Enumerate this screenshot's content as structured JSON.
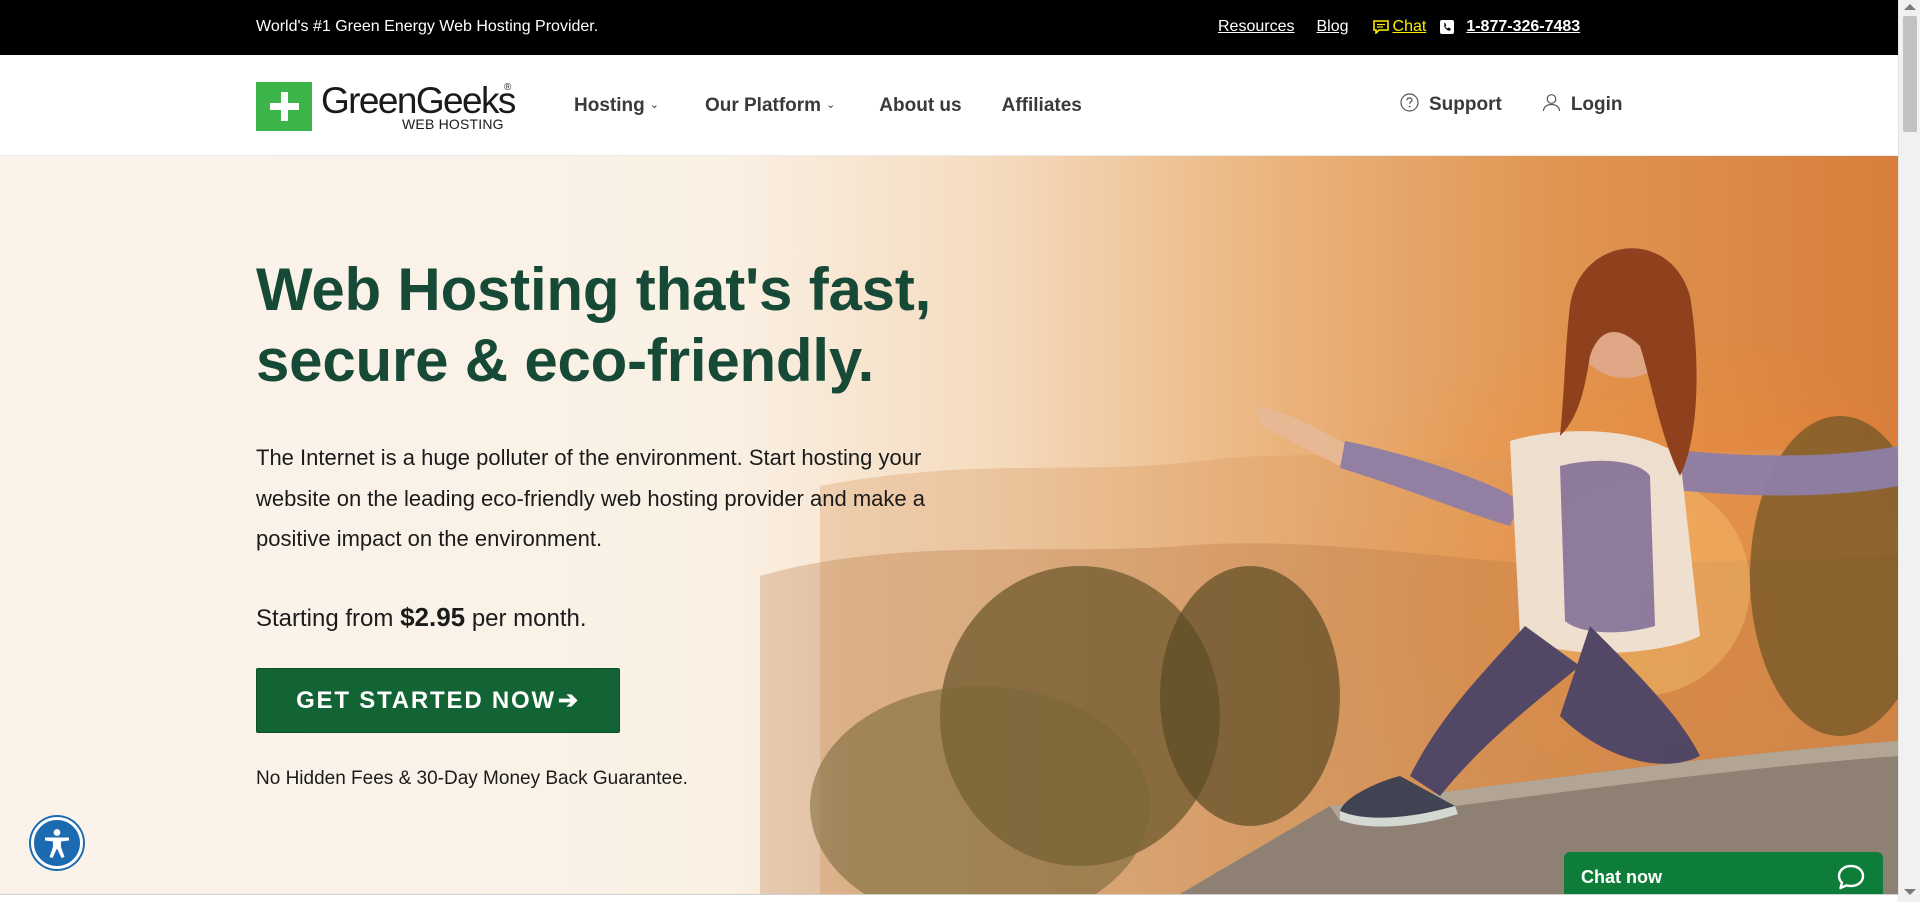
{
  "topbar": {
    "tagline": "World's #1 Green Energy Web Hosting Provider.",
    "resources": "Resources",
    "blog": "Blog",
    "chat": "Chat",
    "phone": "1-877-326-7483"
  },
  "header": {
    "logo_brand": "GreenGeeks",
    "logo_reg": "®",
    "logo_sub": "WEB HOSTING",
    "nav": {
      "hosting": "Hosting",
      "platform": "Our Platform",
      "about": "About us",
      "affiliates": "Affiliates"
    },
    "support": "Support",
    "login": "Login"
  },
  "hero": {
    "headline_line1": "Web Hosting that's fast,",
    "headline_line2": "secure & eco-friendly.",
    "lede": "The Internet is a huge polluter of the environment. Start hosting your website on the leading eco-friendly web hosting provider and make a positive impact on the environment.",
    "price_prefix": "Starting from",
    "price_value": "$2.95",
    "price_suffix": "per month.",
    "cta": "GET STARTED NOW",
    "cta_arrow": "➔",
    "guarantee": "No Hidden Fees & 30-Day Money Back Guarantee."
  },
  "chat_widget": {
    "label": "Chat now"
  },
  "colors": {
    "topbar_bg": "#000000",
    "brand_green": "#3bb44a",
    "headline_green": "#164936",
    "cta_green": "#126434",
    "chat_yellow": "#ffee00",
    "chat_widget_green": "#0f7d3a",
    "a11y_blue": "#1c6ab0"
  },
  "icons": {
    "chat": "chat-bubble-icon",
    "phone": "phone-icon",
    "support": "question-circle-icon",
    "login": "user-icon",
    "chevron": "chevron-down-icon",
    "accessibility": "accessibility-icon",
    "chat_widget": "speech-bubble-icon"
  }
}
